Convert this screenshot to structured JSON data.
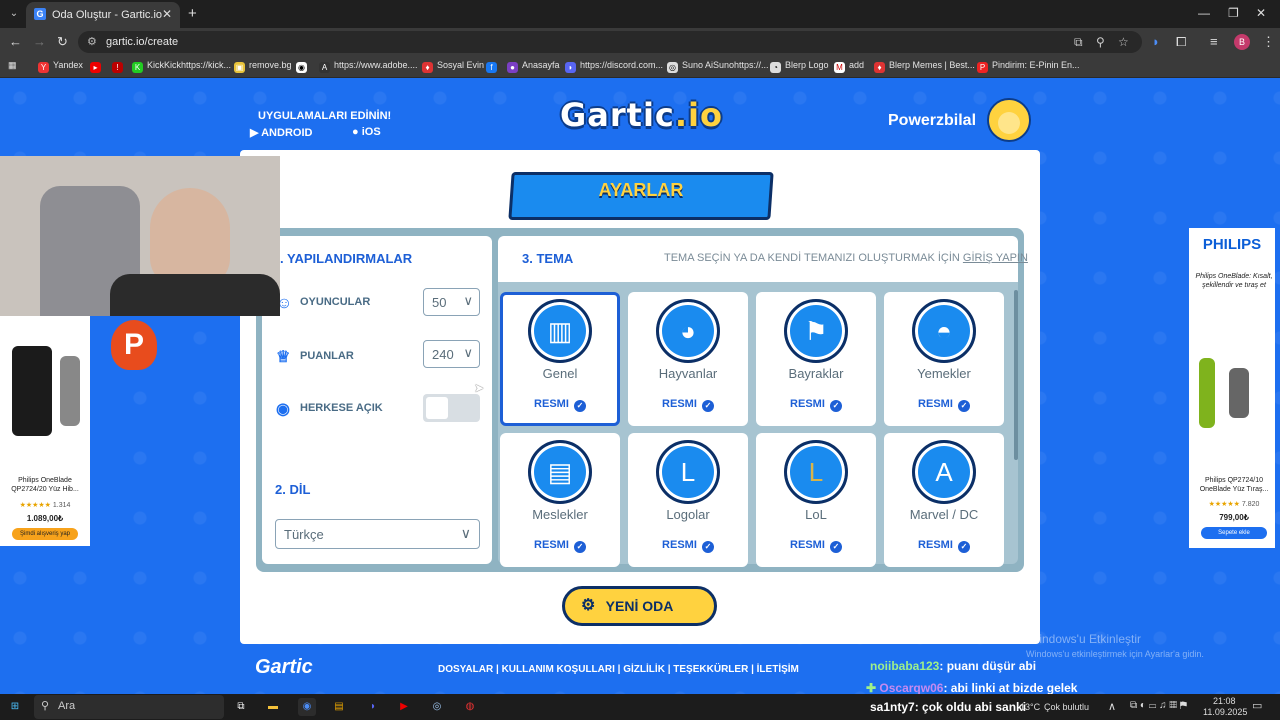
{
  "browser": {
    "tab_title": "Oda Oluştur - Gartic.io",
    "url": "gartic.io/create",
    "bookmarks": [
      "Yandex",
      "KickKickhttps://kick...",
      "remove.bg",
      "https://www.adobe....",
      "Sosyal Evin",
      "Anasayfa",
      "https://discord.com...",
      "Suno AiSunohttps://...",
      "Blerp Logo",
      "add",
      "Blerp Memes | Best...",
      "Pindirim: E-Pinin En..."
    ]
  },
  "header": {
    "apps_title": "UYGULAMALARI EDİNİN!",
    "android": "ANDROID",
    "ios": "iOS",
    "logo_main": "Gartic",
    "logo_suffix": ".io",
    "username": "Powerzbilal"
  },
  "settings": {
    "banner": "AYARLAR",
    "config_title": ". YAPILANDIRMALAR",
    "players_label": "OYUNCULAR",
    "players_value": "50",
    "points_label": "PUANLAR",
    "points_value": "240",
    "public_label": "HERKESE AÇIK",
    "public_on": false,
    "lang_title": "2. DİL",
    "lang_value": "Türkçe",
    "theme_title": "3. TEMA",
    "theme_hint": "TEMA SEÇİN YA DA KENDİ TEMANIZI OLUŞTURMAK İÇİN",
    "login_link": "GİRİŞ YAPIN",
    "themes": [
      {
        "name": "Genel",
        "badge": "RESMI",
        "icon": "slot-machine-icon",
        "selected": true
      },
      {
        "name": "Hayvanlar",
        "badge": "RESMI",
        "icon": "dog-icon",
        "selected": false
      },
      {
        "name": "Bayraklar",
        "badge": "RESMI",
        "icon": "flag-icon",
        "selected": false
      },
      {
        "name": "Yemekler",
        "badge": "RESMI",
        "icon": "burger-icon",
        "selected": false
      },
      {
        "name": "Meslekler",
        "badge": "RESMI",
        "icon": "briefcase-icon",
        "selected": false
      },
      {
        "name": "Logolar",
        "badge": "RESMI",
        "icon": "logo-icon",
        "selected": false
      },
      {
        "name": "LoL",
        "badge": "RESMI",
        "icon": "lol-icon",
        "selected": false
      },
      {
        "name": "Marvel / DC",
        "badge": "RESMI",
        "icon": "captain-america-icon",
        "selected": false
      }
    ],
    "new_room_button": "YENİ ODA"
  },
  "footer": {
    "logo": "Gartic",
    "links": [
      "DOSYALAR",
      "KULLANIM KOŞULLARI",
      "GİZLİLİK",
      "TEŞEKKÜRLER",
      "İLETİŞİM"
    ]
  },
  "ads": {
    "left_title": "Philips OneBlade QP2724/20 Yüz Hib...",
    "left_rating": "1.314",
    "left_price": "1.089,00₺",
    "left_button": "Şimdi alışveriş yap",
    "right_brand": "PHILIPS",
    "right_tagline": "Philips OneBlade: Kısalt, şekillendir ve tıraş et",
    "right_title": "Philips QP2724/10 OneBlade Yüz Tıraş...",
    "right_rating": "7.820",
    "right_price": "799,00₺",
    "right_button": "Sepete ekle"
  },
  "stream_chat": [
    {
      "user": "noiibaba123",
      "message": ": puanı düşür abi"
    },
    {
      "user": "Oscarqw06",
      "message": ": abi linki at bizde gelek"
    },
    {
      "user": "sa1nty7",
      "message": ": çok oldu abi sanki"
    }
  ],
  "windows": {
    "activate_title": "Windows'u Etkinleştir",
    "activate_sub": "Windows'u etkinleştirmek için Ayarlar'a gidin.",
    "search": "Ara",
    "weather_temp": "13°C",
    "weather_text": "Çok bulutlu",
    "time": "21:08",
    "date": "11.09.2025"
  }
}
